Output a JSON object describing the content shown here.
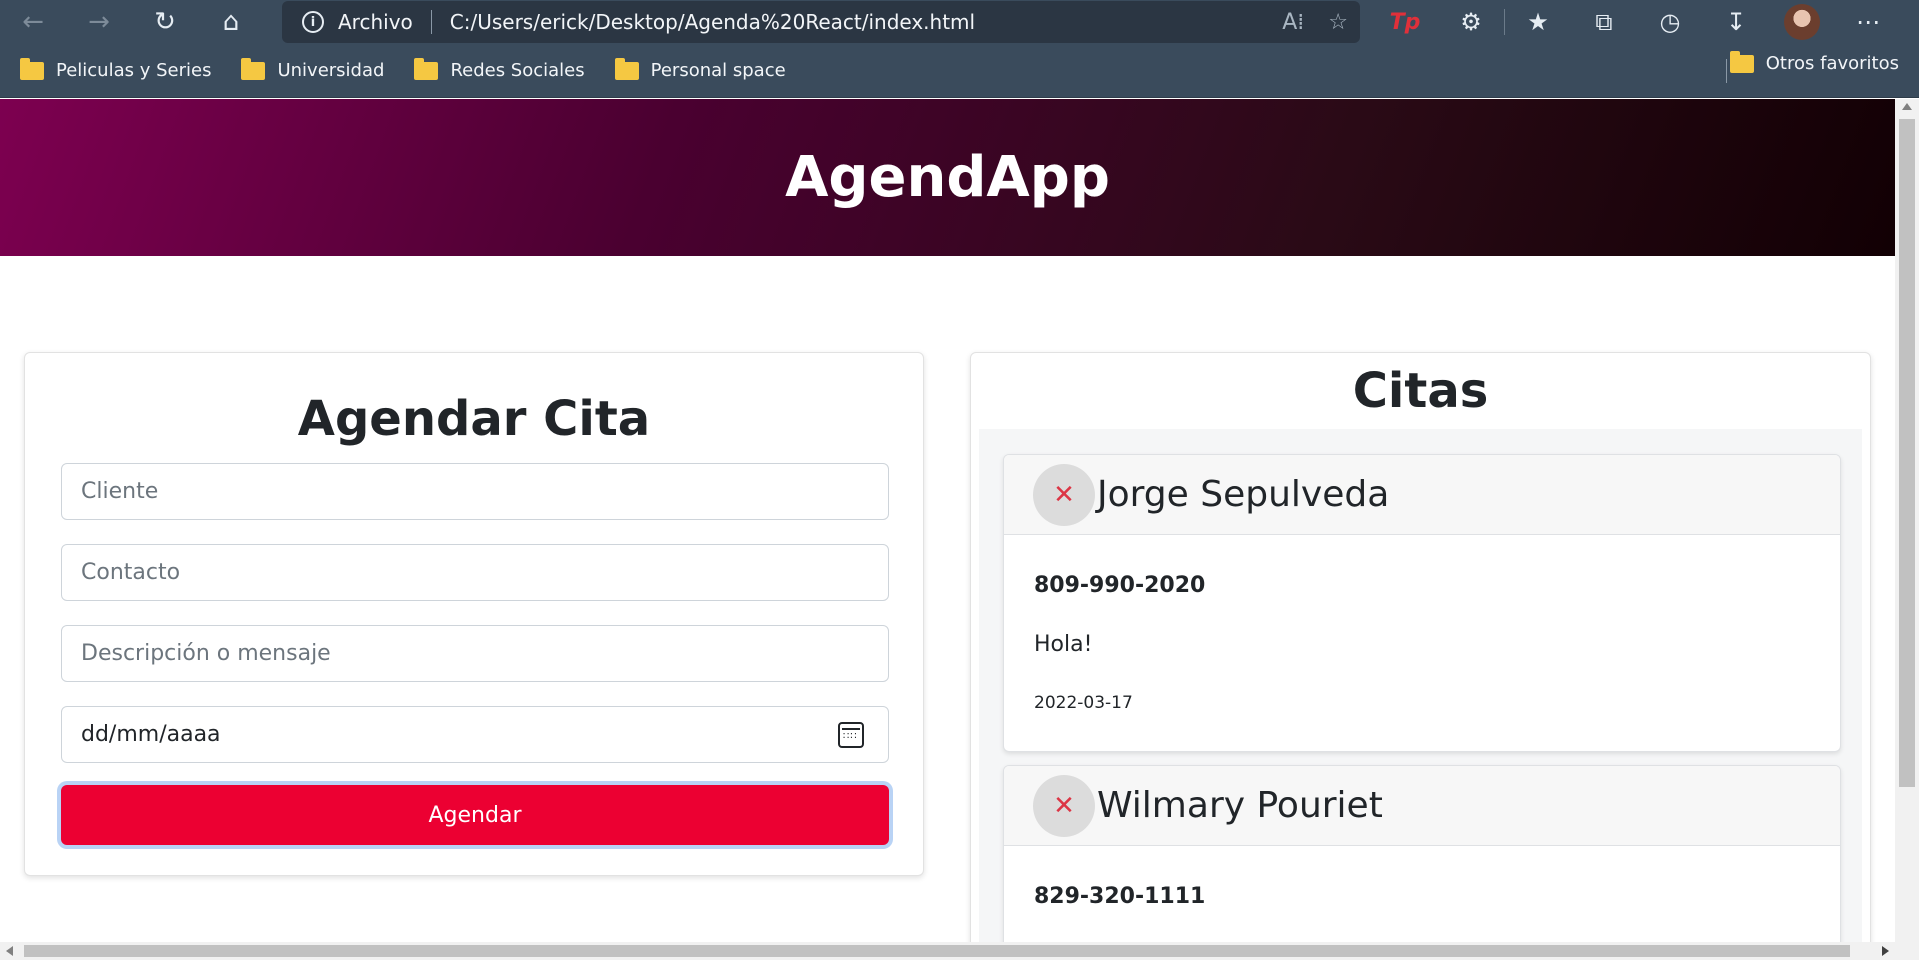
{
  "browser": {
    "address_label": "Archivo",
    "url": "C:/Users/erick/Desktop/Agenda%20React/index.html",
    "bookmarks": [
      "Peliculas y Series",
      "Universidad",
      "Redes Sociales",
      "Personal space"
    ],
    "other_favorites": "Otros favoritos",
    "icons": [
      "back-arrow-icon",
      "forward-arrow-icon",
      "refresh-icon",
      "home-icon",
      "info-icon",
      "read-aloud-icon",
      "add-favorite-icon",
      "tp-extension-icon",
      "extensions-icon",
      "favorites-icon",
      "collections-icon",
      "history-icon",
      "downloads-icon",
      "profile-avatar",
      "more-icon"
    ]
  },
  "app": {
    "title": "AgendApp"
  },
  "form": {
    "title": "Agendar Cita",
    "client_placeholder": "Cliente",
    "contact_placeholder": "Contacto",
    "message_placeholder": "Descripción o mensaje",
    "date_placeholder": "dd/mm/aaaa",
    "submit_label": "Agendar"
  },
  "appointments": {
    "title": "Citas",
    "delete_glyph": "✕",
    "items": [
      {
        "name": "Jorge Sepulveda",
        "contact": "809-990-2020",
        "message": "Hola!",
        "date": "2022-03-17"
      },
      {
        "name": "Wilmary Pouriet",
        "contact": "829-320-1111",
        "message": "",
        "date": ""
      }
    ]
  },
  "colors": {
    "toolbar": "#3a4b5c",
    "hero_start": "#7d0050",
    "hero_end": "#120004",
    "submit_button": "#ec0032",
    "delete_icon": "#dc3545"
  }
}
